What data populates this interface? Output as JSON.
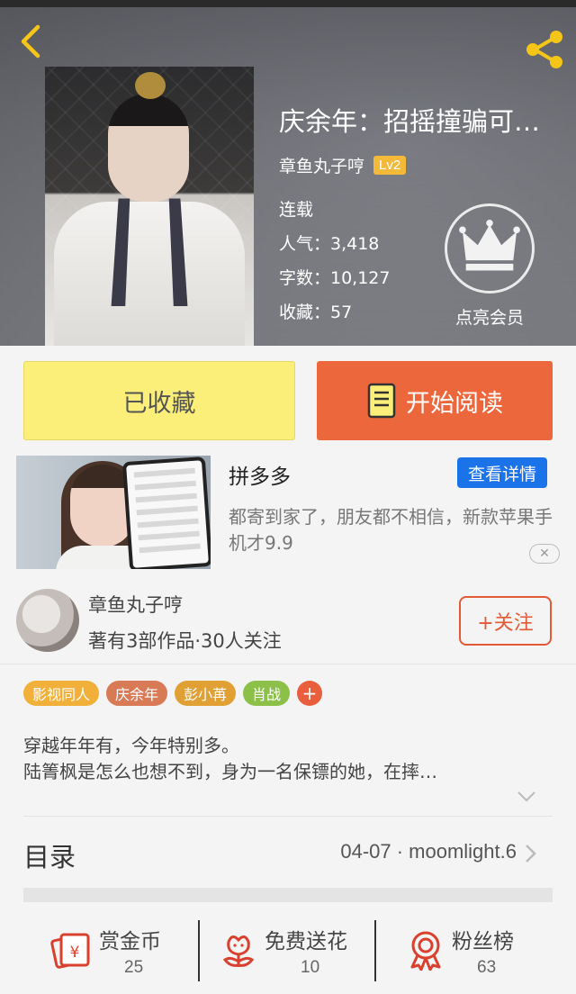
{
  "book": {
    "title": "庆余年：招摇撞骗可…",
    "author": "章鱼丸子哼",
    "author_level": "Lv2",
    "status": "连载",
    "popularity": "人气：3,418",
    "word_count": "字数：10,127",
    "favorites": "收藏：57"
  },
  "vip": {
    "label": "点亮会员"
  },
  "actions": {
    "favorited_label": "已收藏",
    "start_reading_label": "开始阅读"
  },
  "ad": {
    "name": "拼多多",
    "detail_label": "查看详情",
    "description": "都寄到家了，朋友都不相信，新款苹果手机才9.9",
    "close_glyph": "✕"
  },
  "author_card": {
    "name": "章鱼丸子哼",
    "stats": "著有3部作品·30人关注",
    "follow_label": "+关注"
  },
  "tags": [
    {
      "label": "影视同人",
      "color": "#f0b03a"
    },
    {
      "label": "庆余年",
      "color": "#d97a57"
    },
    {
      "label": "彭小苒",
      "color": "#e0a034"
    },
    {
      "label": "肖战",
      "color": "#8cc049"
    }
  ],
  "tag_add": "+",
  "summary": {
    "line1": "穿越年年有，今年特别多。",
    "line2": "陆箐枫是怎么也想不到，身为一名保镖的她，在摔…"
  },
  "toc": {
    "label": "目录",
    "latest": "04-07 · moomlight.6"
  },
  "bottom_bar": {
    "reward": {
      "label": "赏金币",
      "count": "25",
      "icon": "red-envelope-icon"
    },
    "flowers": {
      "label": "免费送花",
      "count": "10",
      "icon": "flower-icon"
    },
    "fans": {
      "label": "粉丝榜",
      "count": "63",
      "icon": "medal-icon"
    }
  },
  "colors": {
    "accent_yellow": "#f5c518",
    "read_button": "#ec683c",
    "favorite_button": "#fbef79",
    "follow": "#e25a35",
    "ad_detail": "#1a73e8",
    "icon_red": "#d9412e"
  }
}
